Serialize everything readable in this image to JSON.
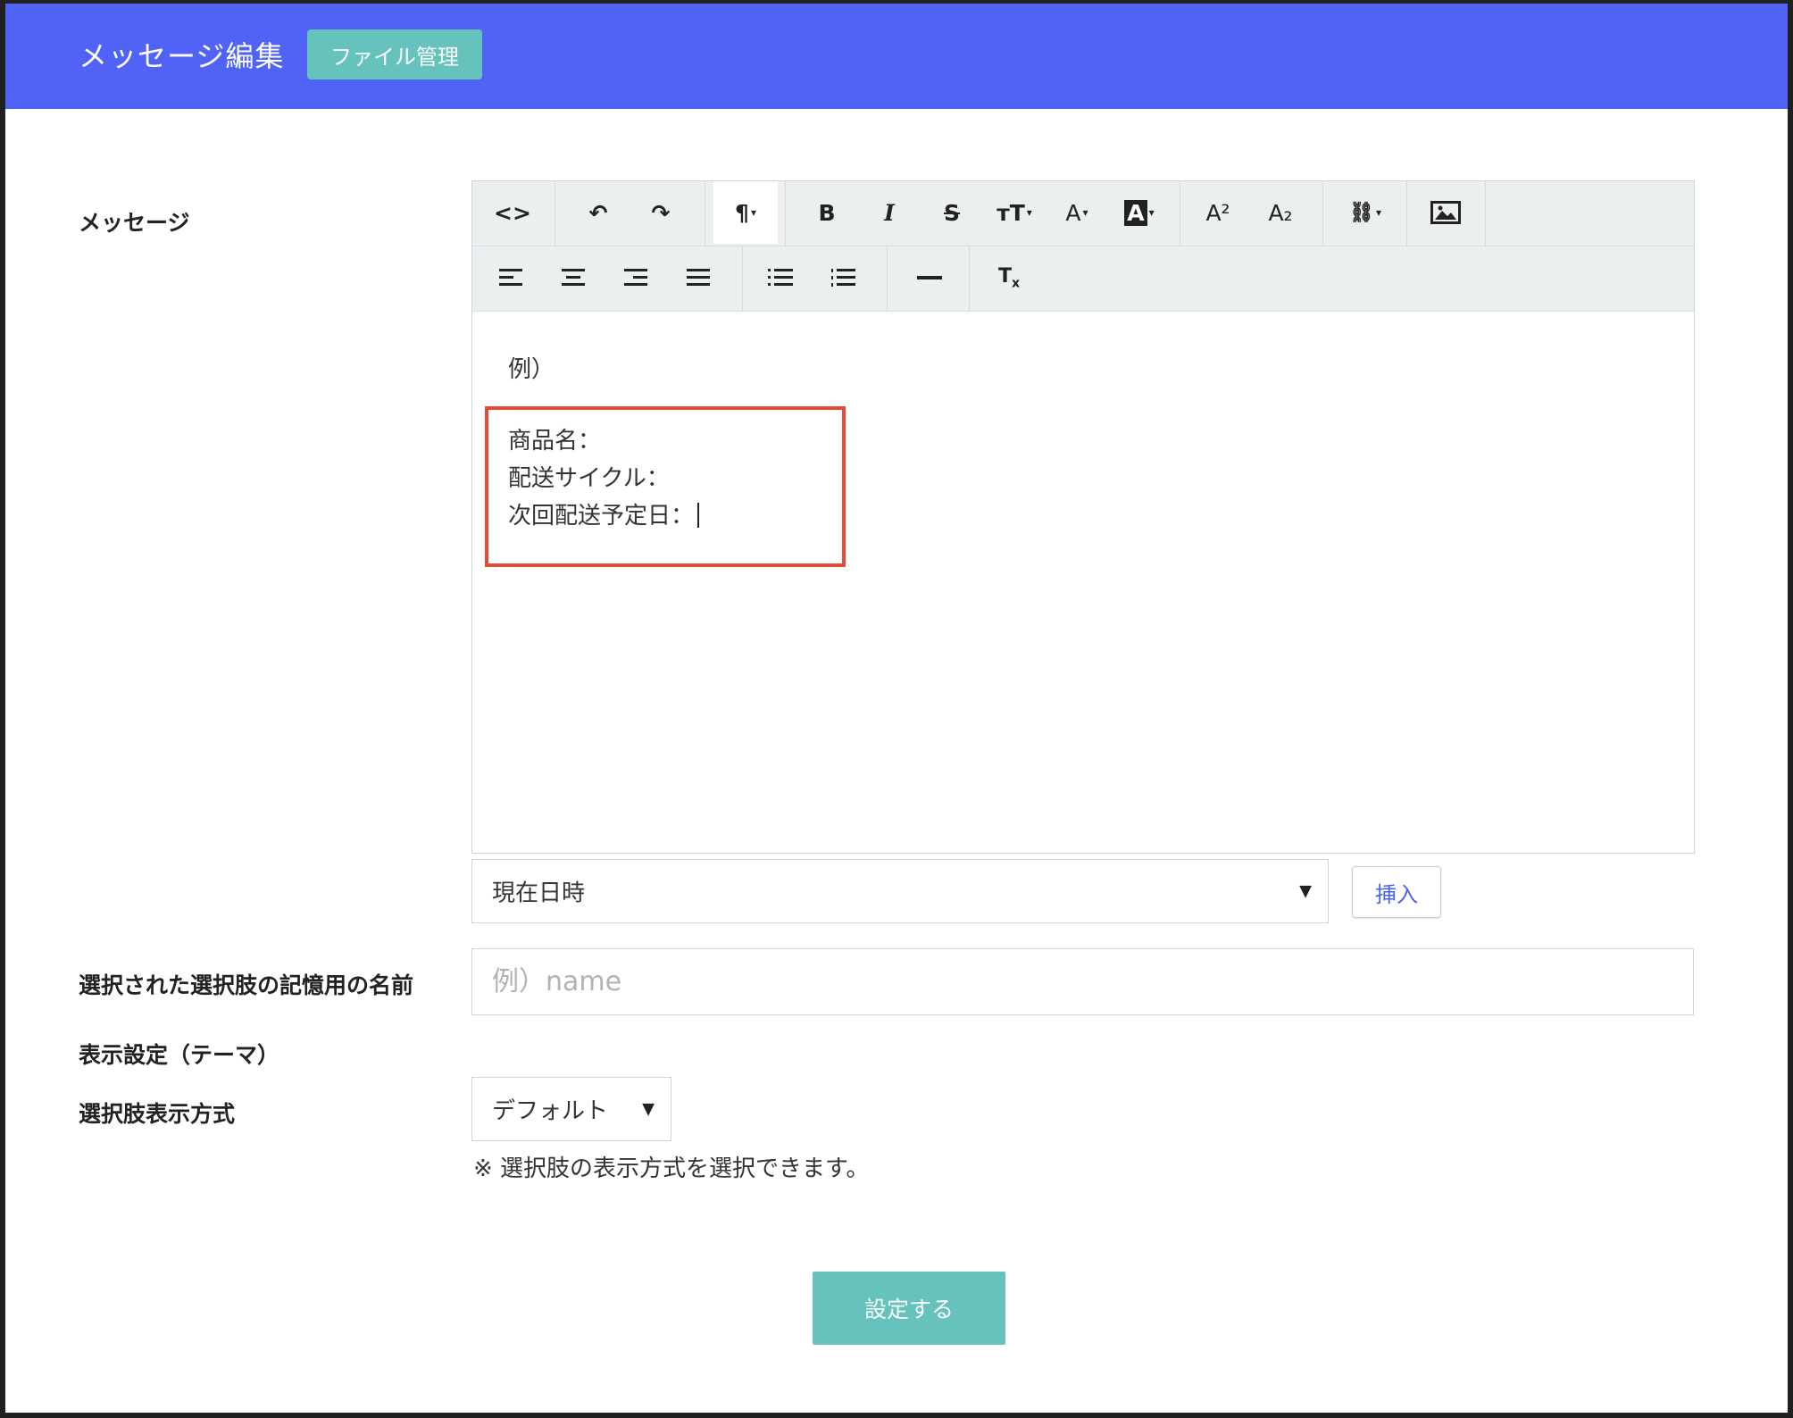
{
  "header": {
    "title": "メッセージ編集",
    "file_button": "ファイル管理"
  },
  "labels": {
    "message": "メッセージ",
    "memory_name": "選択された選択肢の記憶用の名前",
    "display_theme": "表示設定（テーマ）",
    "choice_display": "選択肢表示方式"
  },
  "toolbar": {
    "row1": [
      {
        "name": "code-view-icon",
        "glyph": "<>"
      },
      {
        "name": "undo-icon",
        "glyph": "↶"
      },
      {
        "name": "redo-icon",
        "glyph": "↷"
      },
      {
        "name": "paragraph-format-icon",
        "glyph": "¶"
      },
      {
        "name": "bold-icon",
        "glyph": "B"
      },
      {
        "name": "italic-icon",
        "glyph": "I"
      },
      {
        "name": "strikethrough-icon",
        "glyph": "S"
      },
      {
        "name": "font-size-icon",
        "glyph": "тT"
      },
      {
        "name": "text-color-icon",
        "glyph": "A"
      },
      {
        "name": "background-color-icon",
        "glyph": "A"
      },
      {
        "name": "superscript-icon",
        "glyph": "A²"
      },
      {
        "name": "subscript-icon",
        "glyph": "A₂"
      },
      {
        "name": "link-icon",
        "glyph": "🔗"
      },
      {
        "name": "image-icon",
        "glyph": "▣"
      }
    ],
    "row2": [
      {
        "name": "align-left-icon",
        "glyph": "☰"
      },
      {
        "name": "align-center-icon",
        "glyph": "☰"
      },
      {
        "name": "align-right-icon",
        "glyph": "☰"
      },
      {
        "name": "align-justify-icon",
        "glyph": "☰"
      },
      {
        "name": "unordered-list-icon",
        "glyph": "⁝☰"
      },
      {
        "name": "ordered-list-icon",
        "glyph": "⁝☰"
      },
      {
        "name": "horizontal-rule-icon",
        "glyph": "—"
      },
      {
        "name": "clear-format-icon",
        "glyph": "Tx"
      }
    ]
  },
  "editor": {
    "example": "例）",
    "lines": [
      "商品名：",
      "配送サイクル：",
      "次回配送予定日："
    ]
  },
  "variable_select": {
    "selected": "現在日時"
  },
  "insert_button": "挿入",
  "memory_input": {
    "value": "",
    "placeholder": "例）name"
  },
  "choice_display_select": {
    "selected": "デフォルト"
  },
  "note": "※ 選択肢の表示方式を選択できます。",
  "submit_button": "設定する",
  "colors": {
    "header_bg": "#5063f6",
    "teal_button": "#66c2bd",
    "highlight_border": "#e24a33",
    "toolbar_bg": "#eceff0"
  }
}
